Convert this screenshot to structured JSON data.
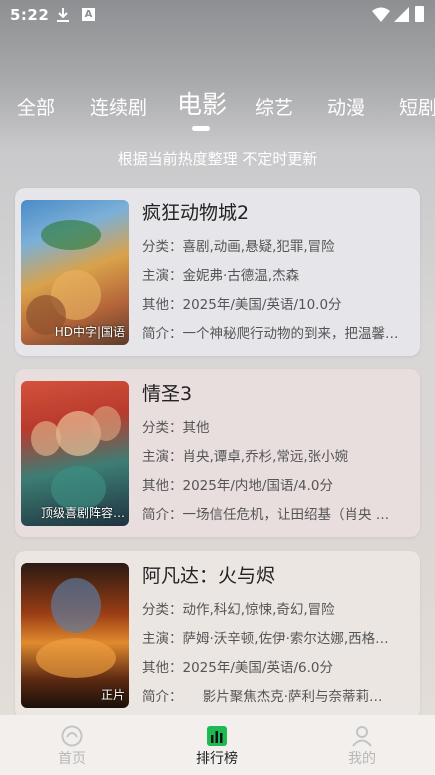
{
  "status_bar": {
    "time": "5:22",
    "notification_letter": "A"
  },
  "tabs": [
    {
      "label": "全部"
    },
    {
      "label": "连续剧"
    },
    {
      "label": "电影",
      "active": true
    },
    {
      "label": "综艺"
    },
    {
      "label": "动漫"
    },
    {
      "label": "短剧"
    }
  ],
  "subtitle": "根据当前热度整理 不定时更新",
  "movies": [
    {
      "title": "疯狂动物城2",
      "poster_tag": "HD中字|国语",
      "genre_label": "分类：",
      "genre": "喜剧,动画,悬疑,犯罪,冒险",
      "cast_label": "主演：",
      "cast": "金妮弗·古德温,杰森",
      "other_label": "其他：",
      "other": "2025年/美国/英语/10.0分",
      "intro_label": "简介：",
      "intro": "一个神秘爬行动物的到来，把温馨…"
    },
    {
      "title": "情圣3",
      "poster_tag": "顶级喜剧阵容…",
      "genre_label": "分类：",
      "genre": "其他",
      "cast_label": "主演：",
      "cast": "肖央,谭卓,乔杉,常远,张小婉",
      "other_label": "其他：",
      "other": "2025年/内地/国语/4.0分",
      "intro_label": "简介：",
      "intro": "一场信任危机，让田绍基（肖央 …"
    },
    {
      "title": "阿凡达：火与烬",
      "poster_tag": "正片",
      "genre_label": "分类：",
      "genre": "动作,科幻,惊悚,奇幻,冒险",
      "cast_label": "主演：",
      "cast": "萨姆·沃辛顿,佐伊·索尔达娜,西格…",
      "other_label": "其他：",
      "other": "2025年/美国/英语/6.0分",
      "intro_label": "简介：",
      "intro": "　　影片聚焦杰克·萨利与奈蒂莉…"
    }
  ],
  "bottom_nav": [
    {
      "label": "首页",
      "icon": "home-icon"
    },
    {
      "label": "排行榜",
      "icon": "ranking-icon",
      "active": true
    },
    {
      "label": "我的",
      "icon": "profile-icon"
    }
  ],
  "colors": {
    "active_nav": "#222222",
    "inactive_nav": "#b8b8b8",
    "ranking_icon_green": "#1db954"
  }
}
